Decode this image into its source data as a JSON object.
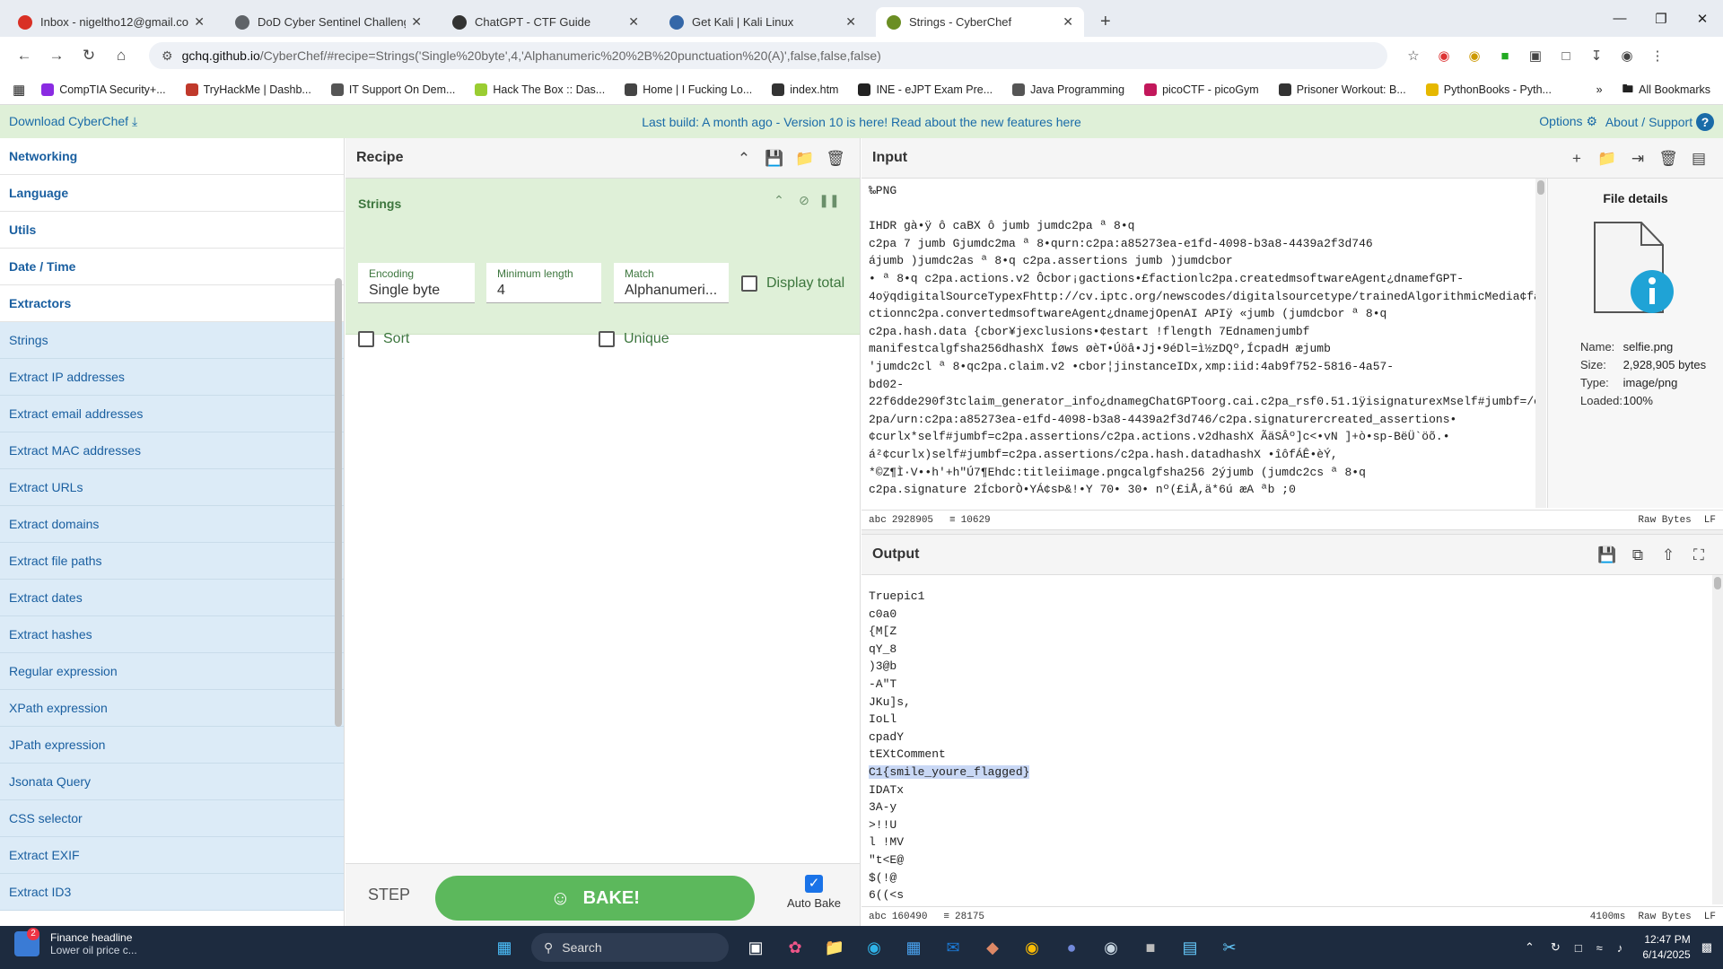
{
  "browser": {
    "tabs": [
      {
        "title": "Inbox - nigeltho12@gmail.com",
        "icon": "gmail-icon",
        "color": "#d93025"
      },
      {
        "title": "DoD Cyber Sentinel Challenge",
        "icon": "globe-icon",
        "color": "#5f6368"
      },
      {
        "title": "ChatGPT - CTF Guide",
        "icon": "chatgpt-icon",
        "color": "#333333"
      },
      {
        "title": "Get Kali | Kali Linux",
        "icon": "kali-icon",
        "color": "#3467a8"
      },
      {
        "title": "Strings - CyberChef",
        "icon": "cyberchef-icon",
        "color": "#6b8e23"
      }
    ],
    "url_host": "gchq.github.io",
    "url_rest": "/CyberChef/#recipe=Strings('Single%20byte',4,'Alphanumeric%20%2B%20punctuation%20(A)',false,false,false)",
    "bookmarks": [
      {
        "label": "CompTIA Security+...",
        "color": "#8a2be2"
      },
      {
        "label": "TryHackMe | Dashb...",
        "color": "#c0392b"
      },
      {
        "label": "IT Support On Dem...",
        "color": "#555555"
      },
      {
        "label": "Hack The Box :: Das...",
        "color": "#9acd32"
      },
      {
        "label": "Home | I Fucking Lo...",
        "color": "#444444"
      },
      {
        "label": "index.htm",
        "color": "#333333"
      },
      {
        "label": "INE - eJPT Exam Pre...",
        "color": "#222222"
      },
      {
        "label": "Java Programming",
        "color": "#555555"
      },
      {
        "label": "picoCTF - picoGym",
        "color": "#c2185b"
      },
      {
        "label": "Prisoner Workout: B...",
        "color": "#333333"
      },
      {
        "label": "PythonBooks - Pyth...",
        "color": "#e6b800"
      }
    ],
    "all_bookmarks": "All Bookmarks"
  },
  "banner": {
    "download": "Download CyberChef",
    "message": "Last build: A month ago - Version 10 is here! Read about the new features here",
    "options": "Options",
    "about": "About / Support"
  },
  "operations": {
    "categories_top": [
      "Networking",
      "Language",
      "Utils",
      "Date / Time",
      "Extractors"
    ],
    "items": [
      "Strings",
      "Extract IP addresses",
      "Extract email addresses",
      "Extract MAC addresses",
      "Extract URLs",
      "Extract domains",
      "Extract file paths",
      "Extract dates",
      "Extract hashes",
      "Regular expression",
      "XPath expression",
      "JPath expression",
      "Jsonata Query",
      "CSS selector",
      "Extract EXIF",
      "Extract ID3"
    ]
  },
  "recipe": {
    "title": "Recipe",
    "op_name": "Strings",
    "encoding_label": "Encoding",
    "encoding_value": "Single byte",
    "minlen_label": "Minimum length",
    "minlen_value": "4",
    "match_label": "Match",
    "match_value": "Alphanumeri...",
    "display_total": "Display total",
    "sort": "Sort",
    "unique": "Unique",
    "step": "STEP",
    "bake": "BAKE!",
    "auto_bake": "Auto Bake"
  },
  "input": {
    "title": "Input",
    "lines": [
      "‰PNG",
      "",
      "IHDR  gà•ÿ  ô caBX  ô jumb  jumdc2pa  ª 8•q",
      "c2pa  7 jumb  Gjumdc2ma  ª 8•qurn:c2pa:a85273ea-e1fd-4098-b3a8-4439a2f3d746",
      "  ájumb  )jumdc2as  ª 8•q  c2pa.assertions  jumb  )jumdcbor",
      "•  ª 8•q  c2pa.actions.v2  Ôcbor¡gactions•£factionlc2pa.createdmsoftwareAgent¿dnamefGPT-",
      "4oÿqdigitalSourceTypexFhttp://cv.iptc.org/newscodes/digitalsourcetype/trainedAlgorithmicMedia¢fa",
      "ctionnc2pa.convertedmsoftwareAgent¿dnamejOpenAI APIÿ  «jumb  (jumdcbor  ª 8•q",
      "  c2pa.hash.data  {cbor¥jexclusions•¢estart !flength 7Ednamenjumbf",
      "manifestcalgfsha256dhashX Íøws øèT•Úöâ•Jj•9éDl=ì½zDQº,ÍcpadH  æjumb",
      "'jumdc2cl  ª 8•qc2pa.claim.v2  •cbor¦jinstanceIDx,xmp:iid:4ab9f752-5816-4a57-",
      "bd02-",
      "22f6dde290f3tclaim_generator_info¿dnamegChatGPToorg.cai.c2pa_rsf0.51.1ÿisignaturexMself#jumbf=/c",
      "2pa/urn:c2pa:a85273ea-e1fd-4098-b3a8-4439a2f3d746/c2pa.signaturercreated_assertions•",
      "¢curlx*self#jumbf=c2pa.assertions/c2pa.actions.v2dhashX ÃäSÂº]c<•vN ]+ò•sp-BëÜ`öõ.•",
      "á²¢curlx)self#jumbf=c2pa.assertions/c2pa.hash.datadhashX •îôfÁÊ•èÝ,",
      "*©Z¶Ì·V••h'+h\"Ú7¶Ehdc:titleiimage.pngcalgfsha256  2ýjumb  (jumdc2cs  ª 8•q",
      "c2pa.signature  2ÍcborÒ•YÁ¢sÞ&!•Y 70• 30•  nº(£iÅ,ä*6ú æA ªb ;0"
    ],
    "status_chars": "2928905",
    "status_lines": "10629",
    "raw_bytes": "Raw Bytes",
    "eol": "LF"
  },
  "file_details": {
    "title": "File details",
    "name_label": "Name:",
    "name": "selfie.png",
    "size_label": "Size:",
    "size": "2,928,905 bytes",
    "type_label": "Type:",
    "type": "image/png",
    "loaded_label": "Loaded:",
    "loaded": "100%"
  },
  "output": {
    "title": "Output",
    "lines": [
      "Truepic1",
      "c0a0",
      "{M[Z",
      "qY_8",
      ")3@b",
      "-A\"T",
      "JKu]s,",
      "IoLl",
      "cpadY",
      "tEXtComment",
      "C1{smile_youre_flagged}",
      "IDATx",
      "3A-y",
      ">!!U",
      "l !MV",
      "\"t<E@",
      "$(!@",
      "6((<s"
    ],
    "highlighted": "C1{smile_youre_flagged}",
    "status_chars": "160490",
    "status_lines": "28175",
    "time": "4100ms",
    "raw_bytes": "Raw Bytes",
    "eol": "LF"
  },
  "taskbar": {
    "weather_title": "Finance headline",
    "weather_sub": "Lower oil price c...",
    "badge": "2",
    "search": "Search",
    "time": "12:47 PM",
    "date": "6/14/2025"
  },
  "colors": {
    "accent_green": "#5cb85c",
    "link_blue": "#1a5fa0",
    "highlight": "#c9d8f5"
  }
}
